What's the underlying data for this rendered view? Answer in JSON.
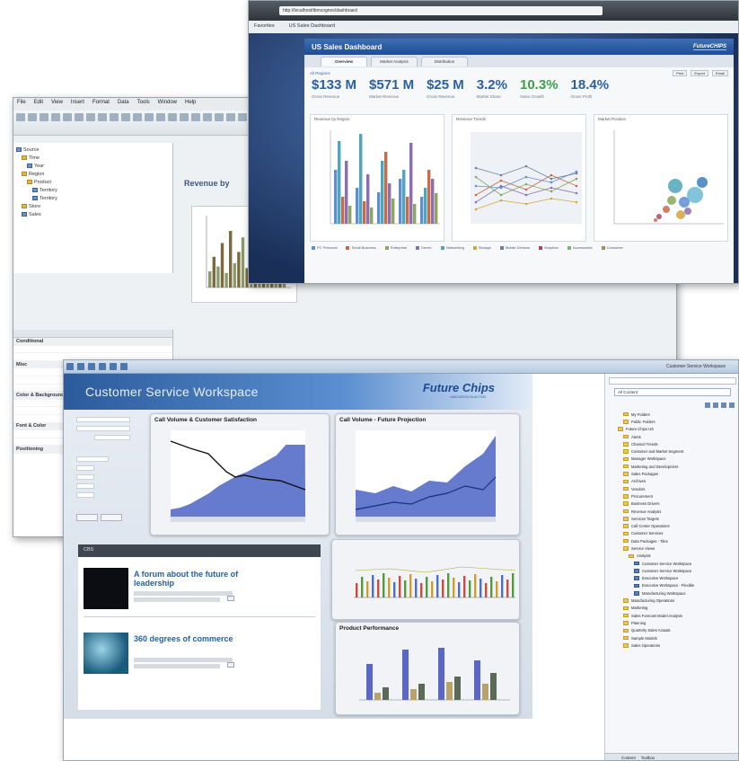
{
  "designer": {
    "menu": [
      "File",
      "Edit",
      "View",
      "Insert",
      "Format",
      "Data",
      "Tools",
      "Window",
      "Help"
    ],
    "tree": [
      "Source",
      "Time",
      "Year",
      "Region",
      "Product",
      "Territory",
      "Territory",
      "Store",
      "Sales"
    ],
    "props_groups": [
      "Conditional",
      "Misc",
      "Color & Background",
      "Font & Color",
      "Positioning"
    ],
    "report_title": "Revenue by",
    "chart_bars": [
      20,
      38,
      26,
      55,
      18,
      70,
      30,
      44,
      62,
      24,
      80,
      36,
      48,
      28,
      66,
      40,
      22,
      52,
      34
    ]
  },
  "sales": {
    "address": "http://localhost/ibmcognos/dashboard",
    "bookmarks": [
      "Favorites",
      "US Sales Dashboard"
    ],
    "title": "US Sales Dashboard",
    "logo": "FutureCHIPS",
    "tabs": [
      "Overview",
      "Market Analysis",
      "Distribution"
    ],
    "filter_label": "All Regions",
    "actions": [
      "Print",
      "Export",
      "Email"
    ],
    "kpis": [
      {
        "value": "$133 M",
        "label": "Gross Revenue",
        "color": "#2b5fa5"
      },
      {
        "value": "$571 M",
        "label": "Market Revenue",
        "color": "#2b5fa5"
      },
      {
        "value": "$25 M",
        "label": "Gross Revenue",
        "color": "#2b5fa5"
      },
      {
        "value": "3.2%",
        "label": "Market Share",
        "color": "#2b5fa5"
      },
      {
        "value": "10.3%",
        "label": "Sales Growth",
        "color": "#3da049"
      },
      {
        "value": "18.4%",
        "label": "Gross Profit",
        "color": "#2b5fa5"
      }
    ],
    "chart_captions": [
      "Revenue by Region",
      "Revenue Trends",
      "Market Position"
    ],
    "legend": [
      "PC Personal",
      "Small Business",
      "Enterprise",
      "Server",
      "Networking",
      "Storage",
      "Mobile Devices",
      "Graphics",
      "Accessories",
      "Consumer"
    ]
  },
  "cs": {
    "status": "Customer Service Workspace",
    "title": "Customer Service Workspace",
    "logo": "Future Chips",
    "logo_sub": "INNOVATION IN ACTION",
    "panel1_title": "Call Volume & Customer Satisfaction",
    "panel2_title": "Call Volume - Future Projection",
    "panel4_title": "Product Performance",
    "news_head": "CBS",
    "news": [
      {
        "headline": "A forum about the future of leadership"
      },
      {
        "headline": "360 degrees of commerce"
      }
    ],
    "explorer_combo": "All Content",
    "explorer_tree": [
      "My Folders",
      "Public Folders",
      "Future Chips US",
      "Alerts",
      "Channel Trends",
      "Customer and Market Segment",
      "Manager Workspace",
      "Marketing and Development",
      "Sales Packages",
      "Archives",
      "Vendors",
      "Procurement",
      "Business Drivers",
      "Revenue Analysis",
      "Services Targets",
      "Call Center Operations",
      "Customer Services",
      "Data Packages - Tiles",
      "Service Views",
      "Analysis",
      "Customer Service Workspace",
      "Customer Service Workspace",
      "Executive Workspace",
      "Executive Workspace - Flexible",
      "Manufacturing Workspace",
      "Manufacturing Operations",
      "Marketing",
      "Sales Forecast Model Analysis",
      "Planning",
      "Quarterly Sales Actuals",
      "Sample Models",
      "Sales Operations"
    ],
    "explorer_tabs": [
      "Content",
      "Toolbox"
    ]
  },
  "colors": {
    "accent": "#2b5fa5",
    "positive": "#3da049",
    "banner": "#2c5b9c"
  }
}
